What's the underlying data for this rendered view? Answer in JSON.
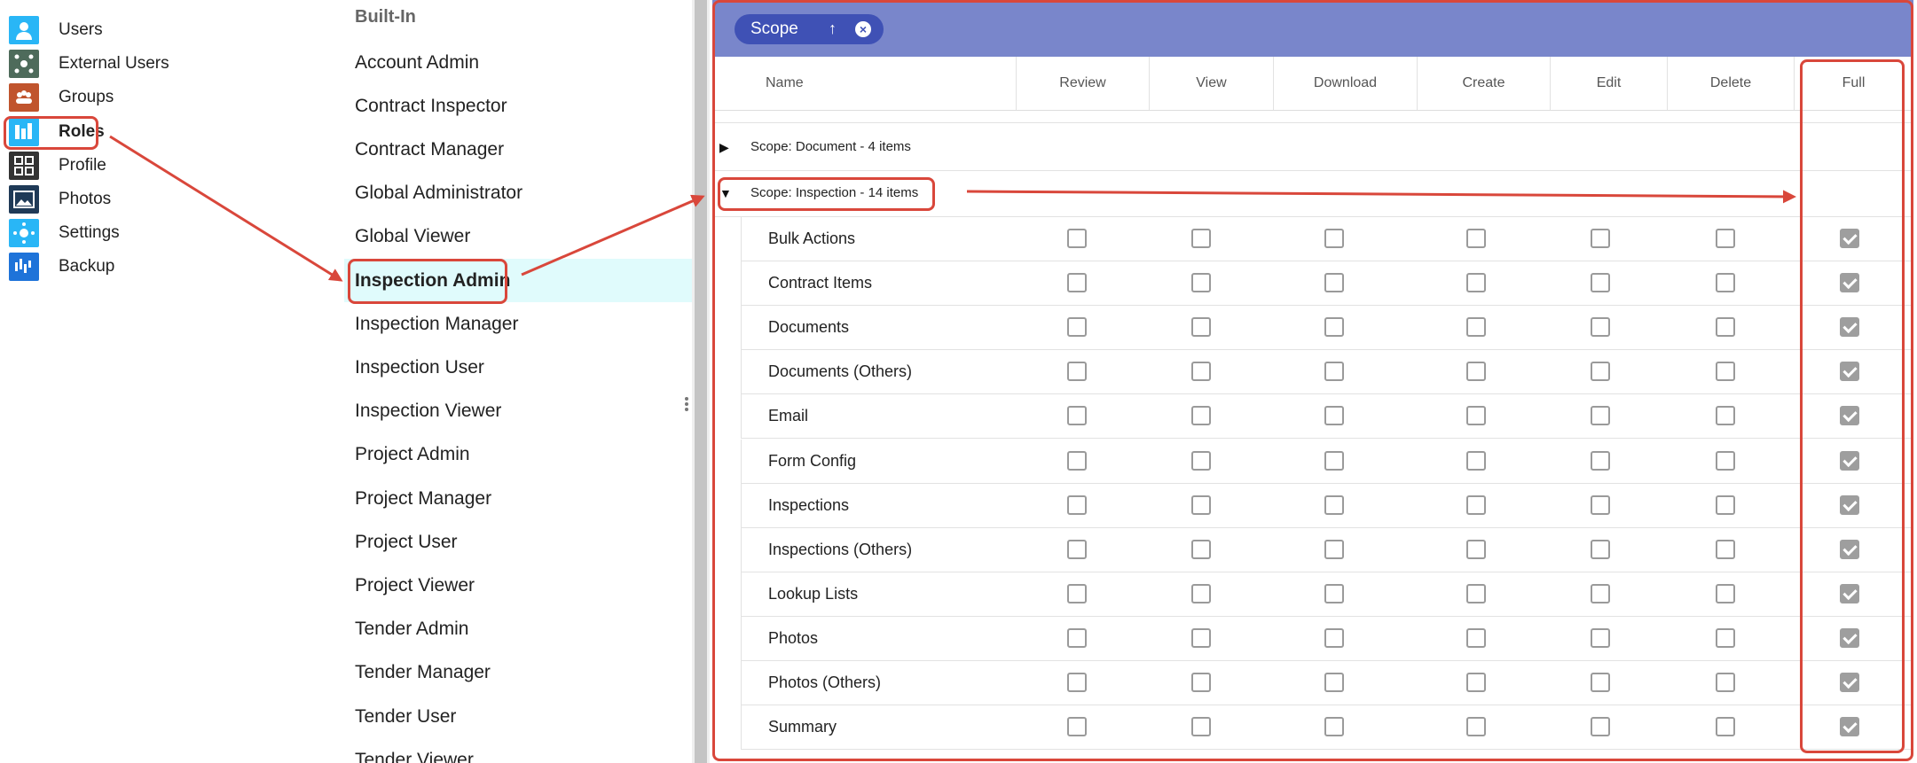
{
  "nav": {
    "items": [
      {
        "label": "Users",
        "icon": "user-icon",
        "color": "#29b6f6"
      },
      {
        "label": "External Users",
        "icon": "external-users-icon",
        "color": "#4e6b5b"
      },
      {
        "label": "Groups",
        "icon": "groups-icon",
        "color": "#c0542d"
      },
      {
        "label": "Roles",
        "icon": "roles-icon",
        "color": "#29b6f6"
      },
      {
        "label": "Profile",
        "icon": "profile-grid-icon",
        "color": "#333333"
      },
      {
        "label": "Photos",
        "icon": "photos-icon",
        "color": "#1f3a57"
      },
      {
        "label": "Settings",
        "icon": "settings-icon",
        "color": "#29b6f6"
      },
      {
        "label": "Backup",
        "icon": "backup-icon",
        "color": "#1e73d9"
      }
    ],
    "active": "Roles"
  },
  "roles": {
    "header": "Built-In",
    "items": [
      "Account Admin",
      "Contract Inspector",
      "Contract Manager",
      "Global Administrator",
      "Global Viewer",
      "Inspection Admin",
      "Inspection Manager",
      "Inspection User",
      "Inspection Viewer",
      "Project Admin",
      "Project Manager",
      "Project User",
      "Project Viewer",
      "Tender Admin",
      "Tender Manager",
      "Tender User",
      "Tender Viewer"
    ],
    "selected": "Inspection Admin"
  },
  "grid": {
    "group_chip": {
      "label": "Scope",
      "sort_icon": "↑",
      "remove_icon": "×"
    },
    "columns": [
      "Name",
      "Review",
      "View",
      "Download",
      "Create",
      "Edit",
      "Delete",
      "Full"
    ],
    "groups": [
      {
        "label": "Scope: Document - 4 items",
        "expanded": false,
        "expand_icon": "▶"
      },
      {
        "label": "Scope: Inspection - 14 items",
        "expanded": true,
        "expand_icon": "▼"
      }
    ],
    "rows": [
      {
        "name": "Bulk Actions",
        "checked": [
          false,
          false,
          false,
          false,
          false,
          false,
          true
        ]
      },
      {
        "name": "Contract Items",
        "checked": [
          false,
          false,
          false,
          false,
          false,
          false,
          true
        ]
      },
      {
        "name": "Documents",
        "checked": [
          false,
          false,
          false,
          false,
          false,
          false,
          true
        ]
      },
      {
        "name": "Documents (Others)",
        "checked": [
          false,
          false,
          false,
          false,
          false,
          false,
          true
        ]
      },
      {
        "name": "Email",
        "checked": [
          false,
          false,
          false,
          false,
          false,
          false,
          true
        ]
      },
      {
        "name": "Form Config",
        "checked": [
          false,
          false,
          false,
          false,
          false,
          false,
          true
        ]
      },
      {
        "name": "Inspections",
        "checked": [
          false,
          false,
          false,
          false,
          false,
          false,
          true
        ]
      },
      {
        "name": "Inspections (Others)",
        "checked": [
          false,
          false,
          false,
          false,
          false,
          false,
          true
        ]
      },
      {
        "name": "Lookup Lists",
        "checked": [
          false,
          false,
          false,
          false,
          false,
          false,
          true
        ]
      },
      {
        "name": "Photos",
        "checked": [
          false,
          false,
          false,
          false,
          false,
          false,
          true
        ]
      },
      {
        "name": "Photos (Others)",
        "checked": [
          false,
          false,
          false,
          false,
          false,
          false,
          true
        ]
      },
      {
        "name": "Summary",
        "checked": [
          false,
          false,
          false,
          false,
          false,
          false,
          true
        ]
      }
    ]
  },
  "colors": {
    "accent": "#7986cb",
    "chip": "#3f51b5",
    "annotation": "#d9473b",
    "selected_bg": "#e0fbfc"
  }
}
